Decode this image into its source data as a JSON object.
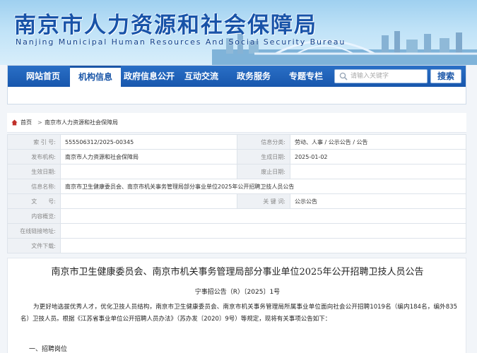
{
  "site": {
    "title": "南京市人力资源和社会保障局",
    "subtitle": "Nanjing Municipal Human Resources And Social Security Bureau"
  },
  "nav": {
    "items": [
      {
        "label": "网站首页"
      },
      {
        "label": "机构信息"
      },
      {
        "label": "政府信息公开"
      },
      {
        "label": "互动交流"
      },
      {
        "label": "政务服务"
      },
      {
        "label": "专题专栏"
      }
    ],
    "active_index": 1,
    "search_placeholder": "请输入关键字",
    "search_label": "搜索"
  },
  "breadcrumb": {
    "home": "首页",
    "separator": ">",
    "current": "南京市人力资源和社会保障局"
  },
  "info_table": {
    "index_label": "索 引 号:",
    "index_value": "555506312/2025-00345",
    "category_label": "信息分类:",
    "category_value": "劳动、人事 / 公示公告 / 公告",
    "publisher_label": "发布机构:",
    "publisher_value": "南京市人力资源和社会保障局",
    "gen_date_label": "生成日期:",
    "gen_date_value": "2025-01-02",
    "effective_label": "生效日期:",
    "effective_value": "",
    "expire_label": "废止日期:",
    "expire_value": "",
    "name_label": "信息名称:",
    "name_value": "南京市卫生健康委员会、南京市机关事务管理局部分事业单位2025年公开招聘卫技人员公告",
    "docno_label": "文　　号:",
    "docno_value": "",
    "keywords_label": "关 键 词:",
    "keywords_value": "公示公告",
    "summary_label": "内容概览:",
    "summary_value": "",
    "link_label": "在线链接地址:",
    "link_value": "",
    "download_label": "文件下载:",
    "download_value": ""
  },
  "article": {
    "title": "南京市卫生健康委员会、南京市机关事务管理局部分事业单位2025年公开招聘卫技人员公告",
    "doc_number": "宁事招公告（R）〔2025〕1号",
    "paragraph": "为更好地选拔优秀人才，优化卫技人员结构，南京市卫生健康委员会、南京市机关事务管理局所属事业单位面向社会公开招聘1019名（编内184名，编外835名）卫技人员。根据《江苏省事业单位公开招聘人员办法》（苏办发〔2020〕9号）等规定，现将有关事项公告如下：",
    "section1": "一、招聘岗位"
  },
  "colors": {
    "nav_blue": "#1a5fb8",
    "title_blue": "#1853a8"
  }
}
